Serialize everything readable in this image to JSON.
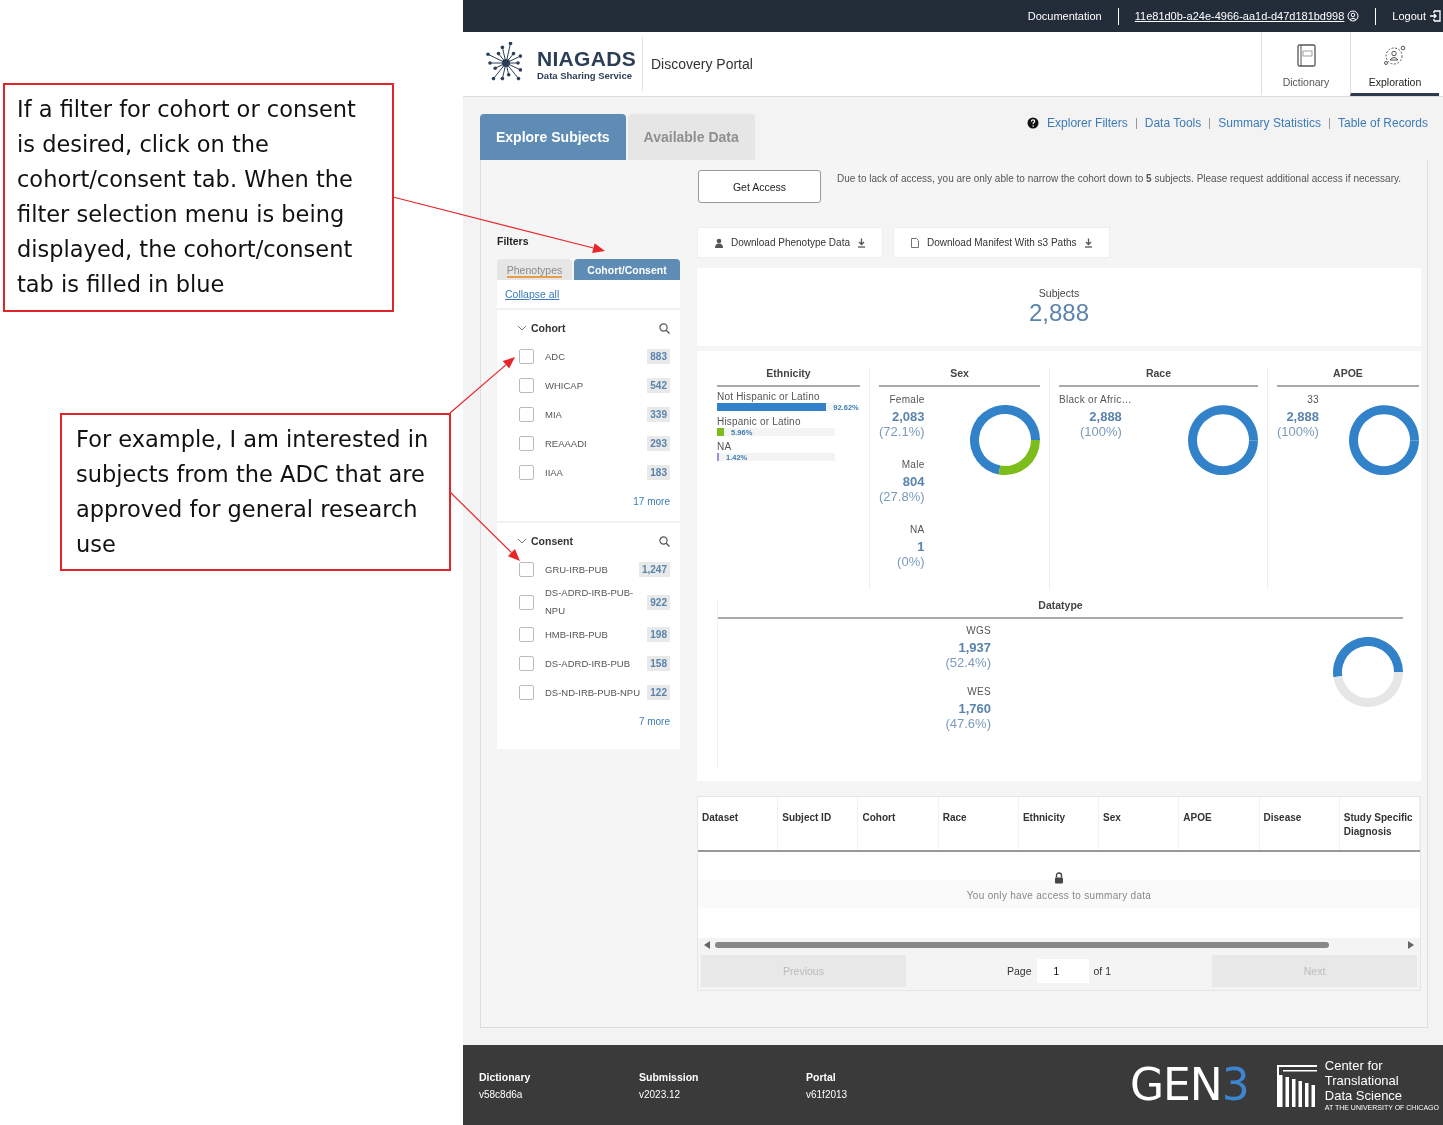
{
  "annotations": [
    {
      "text": "If a filter for cohort or consent is desired, click on the cohort/consent  tab. When the filter selection menu is being displayed, the cohort/consent tab is filled in blue"
    },
    {
      "text": "For example, I am interested in subjects from the ADC that are approved for general research use"
    }
  ],
  "top_bar": {
    "documentation": "Documentation",
    "user": "11e81d0b-a24e-4966-aa1d-d47d181bd998",
    "logout": "Logout"
  },
  "header": {
    "logo": {
      "name": "NIAGADS",
      "subtitle": "Data Sharing Service"
    },
    "portal_title": "Discovery Portal",
    "nav": [
      {
        "label": "Dictionary",
        "kind": "dictionary",
        "selected": false
      },
      {
        "label": "Exploration",
        "kind": "exploration",
        "selected": true
      }
    ]
  },
  "page_tabs": [
    {
      "label": "Explore Subjects",
      "selected": true
    },
    {
      "label": "Available Data",
      "selected": false
    }
  ],
  "quick_links": [
    "Explorer Filters",
    "Data Tools",
    "Summary Statistics",
    "Table of Records"
  ],
  "access_notice": {
    "button": "Get Access",
    "message": "Due to lack of access, you are only able to narrow the cohort down to **5** subjects. Please request additional access if necessary."
  },
  "filters": {
    "title": "Filters",
    "tabs": [
      {
        "label": "Phenotypes",
        "selected": false
      },
      {
        "label": "Cohort/Consent",
        "selected": true
      }
    ],
    "collapse": "Collapse all",
    "groups": [
      {
        "title": "Cohort",
        "expanded": true,
        "more": "17 more",
        "options": [
          {
            "label": "ADC",
            "count": "883",
            "checked": false
          },
          {
            "label": "WHICAP",
            "count": "542",
            "checked": false
          },
          {
            "label": "MIA",
            "count": "339",
            "checked": false
          },
          {
            "label": "REAAADI",
            "count": "293",
            "checked": false
          },
          {
            "label": "IIAA",
            "count": "183",
            "checked": false
          }
        ]
      },
      {
        "title": "Consent",
        "expanded": true,
        "more": "7 more",
        "options": [
          {
            "label": "GRU-IRB-PUB",
            "count": "1,247",
            "checked": false
          },
          {
            "label": "DS-ADRD-IRB-PUB-NPU",
            "count": "922",
            "checked": false
          },
          {
            "label": "HMB-IRB-PUB",
            "count": "198",
            "checked": false
          },
          {
            "label": "DS-ADRD-IRB-PUB",
            "count": "158",
            "checked": false
          },
          {
            "label": "DS-ND-IRB-PUB-NPU",
            "count": "122",
            "checked": false
          }
        ]
      }
    ]
  },
  "downloads": [
    {
      "label": "Download Phenotype Data",
      "kind": "person"
    },
    {
      "label": "Download Manifest With s3 Paths",
      "kind": "file"
    }
  ],
  "summary": {
    "label": "Subjects",
    "value": "2,888"
  },
  "ethnicity": {
    "title": "Ethnicity",
    "bars": [
      {
        "label": "Not Hispanic or Latino",
        "level": 0.9262,
        "percent": "92.62%",
        "color": "#3182c9"
      },
      {
        "label": "Hispanic or Latino",
        "level": 0.0596,
        "percent": "5.96%",
        "color": "#7dbd1b"
      },
      {
        "label": "NA",
        "level": 0.0142,
        "percent": "1.42%",
        "color": "#a58ae6"
      }
    ]
  },
  "donut_panels": [
    {
      "title": "Sex",
      "kind": "donut",
      "items": [
        {
          "label": "Female",
          "count": "2,083",
          "percent": "(72.1%)"
        },
        {
          "label": "Male",
          "count": "804",
          "percent": "(27.8%)"
        },
        {
          "label": "NA",
          "count": "1",
          "percent": "(0%)"
        }
      ]
    },
    {
      "title": "Race",
      "kind": "donut",
      "items": [
        {
          "label": "Black or Afric…",
          "count": "2,888",
          "percent": "(100%)"
        }
      ]
    },
    {
      "title": "APOE",
      "kind": "donut",
      "items": [
        {
          "label": "33",
          "count": "2,888",
          "percent": "(100%)"
        }
      ]
    }
  ],
  "datatype": {
    "title": "Datatype",
    "kind": "gauge",
    "items": [
      {
        "label": "WGS",
        "count": "1,937",
        "percent": "(52.4%)"
      },
      {
        "label": "WES",
        "count": "1,760",
        "percent": "(47.6%)"
      }
    ]
  },
  "table": {
    "columns": [
      "Dataset",
      "Subject ID",
      "Cohort",
      "Race",
      "Ethnicity",
      "Sex",
      "APOE",
      "Disease",
      "Study Specific Diagnosis"
    ],
    "empty_message": "You only have access to summary data"
  },
  "pagination": {
    "previous": "Previous",
    "page_label": "Page",
    "page": "1",
    "of": "of 1",
    "next": "Next"
  },
  "footer": {
    "items": [
      {
        "label": "Dictionary",
        "value": "v58c8d6a"
      },
      {
        "label": "Submission",
        "value": "v2023.12"
      },
      {
        "label": "Portal",
        "value": "v61f2013"
      }
    ],
    "gen3": {
      "text": "GEN",
      "accent": "3"
    },
    "ctds": {
      "lines": [
        "Center for",
        "Translational",
        "Data Science"
      ],
      "tagline": "AT THE UNIVERSITY OF CHICAGO"
    }
  }
}
